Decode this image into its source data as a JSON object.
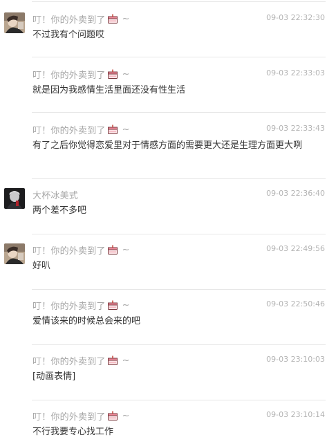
{
  "messages": [
    {
      "sender": "叮！你的外卖到了",
      "suffix": "~",
      "time": "09-03 22:32:30",
      "text": "不过我有个问题哎",
      "avatar": "girl-photo"
    },
    {
      "sender": "叮！你的外卖到了",
      "suffix": "~",
      "time": "09-03 22:33:03",
      "text": "就是因为我感情生活里面还没有性生活",
      "avatar": null
    },
    {
      "sender": "叮！你的外卖到了",
      "suffix": "~",
      "time": "09-03 22:33:43",
      "text": "有了之后你觉得恋爱里对于情感方面的需要更大还是生理方面更大咧",
      "avatar": null
    },
    {
      "sender": "大杯冰美式",
      "suffix": "",
      "time": "09-03 22:36:40",
      "text": "两个差不多吧",
      "avatar": "dark-photo"
    },
    {
      "sender": "叮！你的外卖到了",
      "suffix": "~",
      "time": "09-03 22:49:56",
      "text": "好叭",
      "avatar": "girl-photo"
    },
    {
      "sender": "叮！你的外卖到了",
      "suffix": "~",
      "time": "09-03 22:50:46",
      "text": "爱情该来的时候总会来的吧",
      "avatar": null
    },
    {
      "sender": "叮！你的外卖到了",
      "suffix": "~",
      "time": "09-03 23:10:03",
      "text": "[动画表情]",
      "avatar": null
    },
    {
      "sender": "叮！你的外卖到了",
      "suffix": "~",
      "time": "09-03 23:10:14",
      "text": "不行我要专心找工作",
      "avatar": null
    }
  ],
  "colors": {
    "sender": "#a6a6a6",
    "time": "#b3b3b3",
    "text": "#333333",
    "divider": "#e6e6e6"
  }
}
